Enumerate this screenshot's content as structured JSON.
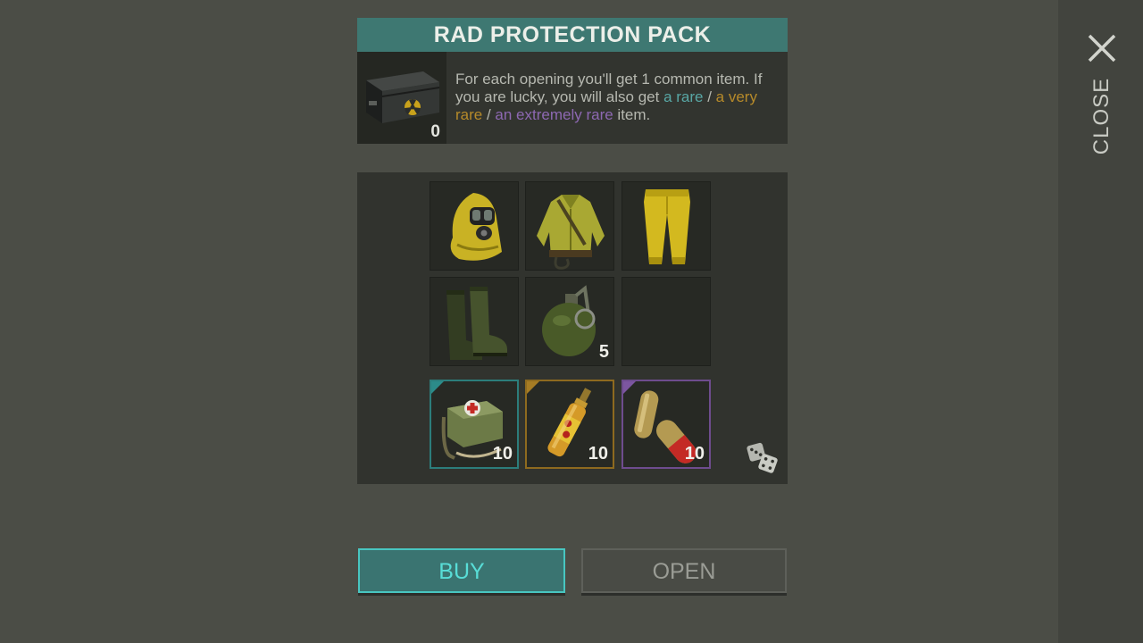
{
  "pack": {
    "title": "RAD PROTECTION PACK",
    "crate_count": "0",
    "description": {
      "p1": "For each opening you'll get 1 common item. If you are lucky, you will also get ",
      "rare": "a rare",
      "sep1": " / ",
      "very_rare": "a very rare",
      "sep2": " / ",
      "extremely_rare": "an extremely rare",
      "p2": " item."
    }
  },
  "items": [
    {
      "icon": "hazmat-hood-icon",
      "qty": "",
      "rarity": "common"
    },
    {
      "icon": "hazmat-jacket-icon",
      "qty": "",
      "rarity": "common"
    },
    {
      "icon": "hazmat-pants-icon",
      "qty": "",
      "rarity": "common"
    },
    {
      "icon": "rubber-boots-icon",
      "qty": "",
      "rarity": "common"
    },
    {
      "icon": "grenade-icon",
      "qty": "5",
      "rarity": "common"
    },
    {
      "icon": "empty-slot",
      "qty": "",
      "rarity": "empty"
    },
    {
      "icon": "medical-bag-icon",
      "qty": "10",
      "rarity": "rare"
    },
    {
      "icon": "ampoule-icon",
      "qty": "10",
      "rarity": "very-rare"
    },
    {
      "icon": "pills-icon",
      "qty": "10",
      "rarity": "extremely-rare"
    }
  ],
  "buttons": {
    "buy": "BUY",
    "open": "OPEN"
  },
  "close": {
    "label": "CLOSE"
  },
  "colors": {
    "title_bar": "#3e7872",
    "rare": "#58a7a5",
    "very_rare": "#b68a2a",
    "extremely_rare": "#8d68b2",
    "buy_accent": "#48c6c1"
  }
}
